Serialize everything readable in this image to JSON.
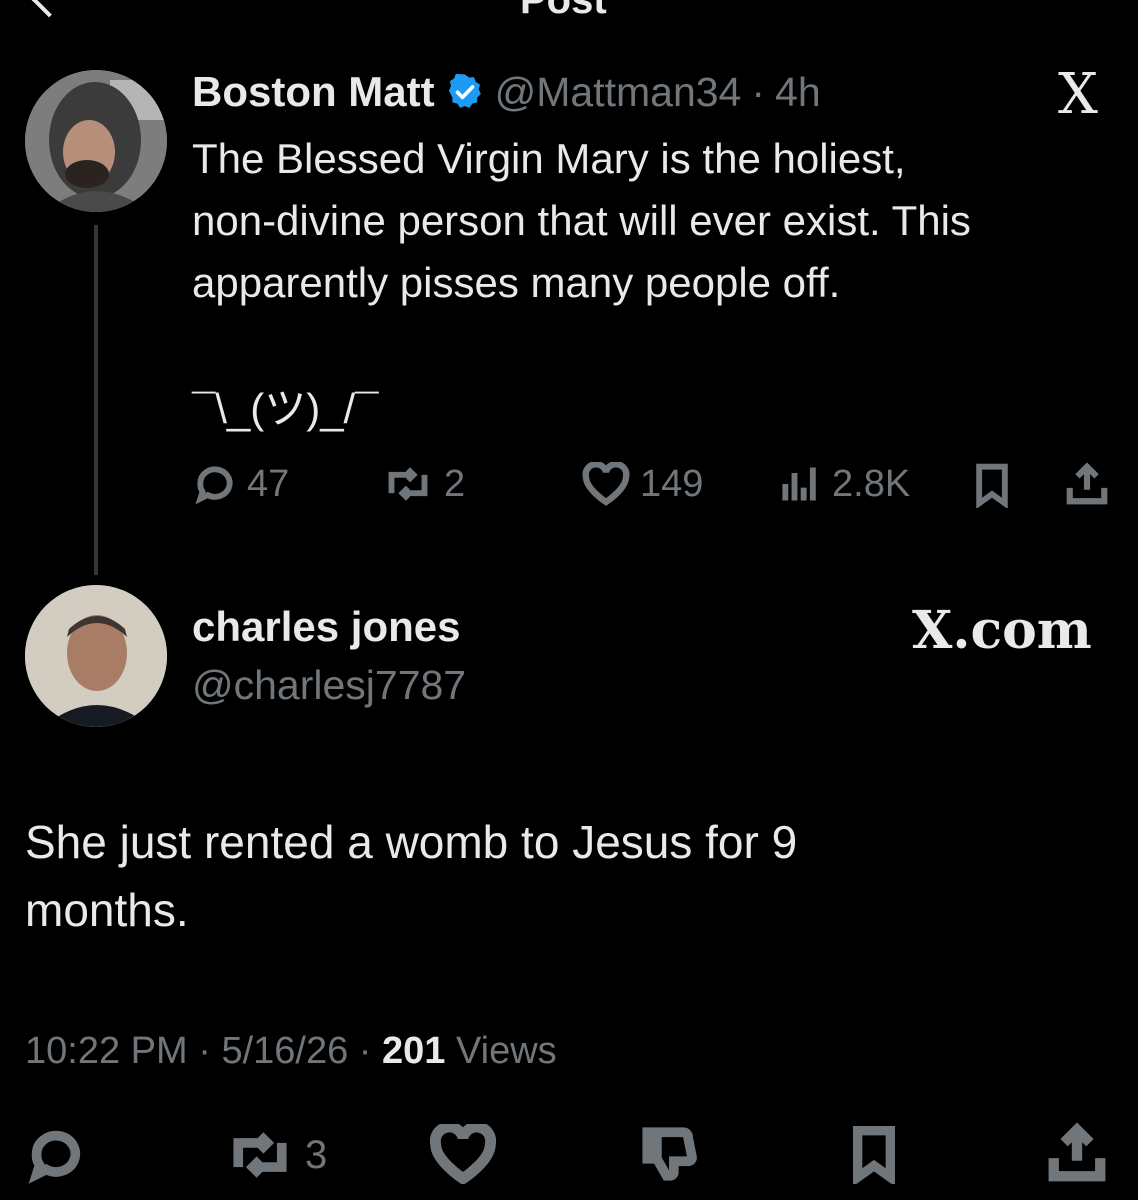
{
  "header": {
    "title": "Post"
  },
  "parent_post": {
    "author_name": "Boston Matt",
    "handle": "@Mattman34",
    "separator": "·",
    "time": "4h",
    "x_logo": "X",
    "verified_icon": "verified-badge-icon",
    "text_lines": [
      "The Blessed Virgin Mary is the holiest,",
      "non-divine person that will ever exist.  This",
      "apparently pisses many people off."
    ],
    "shrug": "¯\\_(ツ)_/¯",
    "metrics": {
      "replies": "47",
      "reposts": "2",
      "likes": "149",
      "views": "2.8K"
    }
  },
  "reply_post": {
    "author_name": "charles jones",
    "handle": "@charlesj7787",
    "watermark": "X.com",
    "text_lines": [
      "She just rented a womb to Jesus for 9",
      "months."
    ],
    "time": "10:22 PM",
    "sep": "·",
    "date": "5/16/26",
    "views_count": "201",
    "views_label": "Views",
    "actions": {
      "reposts": "3"
    }
  },
  "colors": {
    "background": "#000000",
    "text": "#e7e9ea",
    "muted": "#71767b",
    "verified": "#1d9bf0"
  }
}
